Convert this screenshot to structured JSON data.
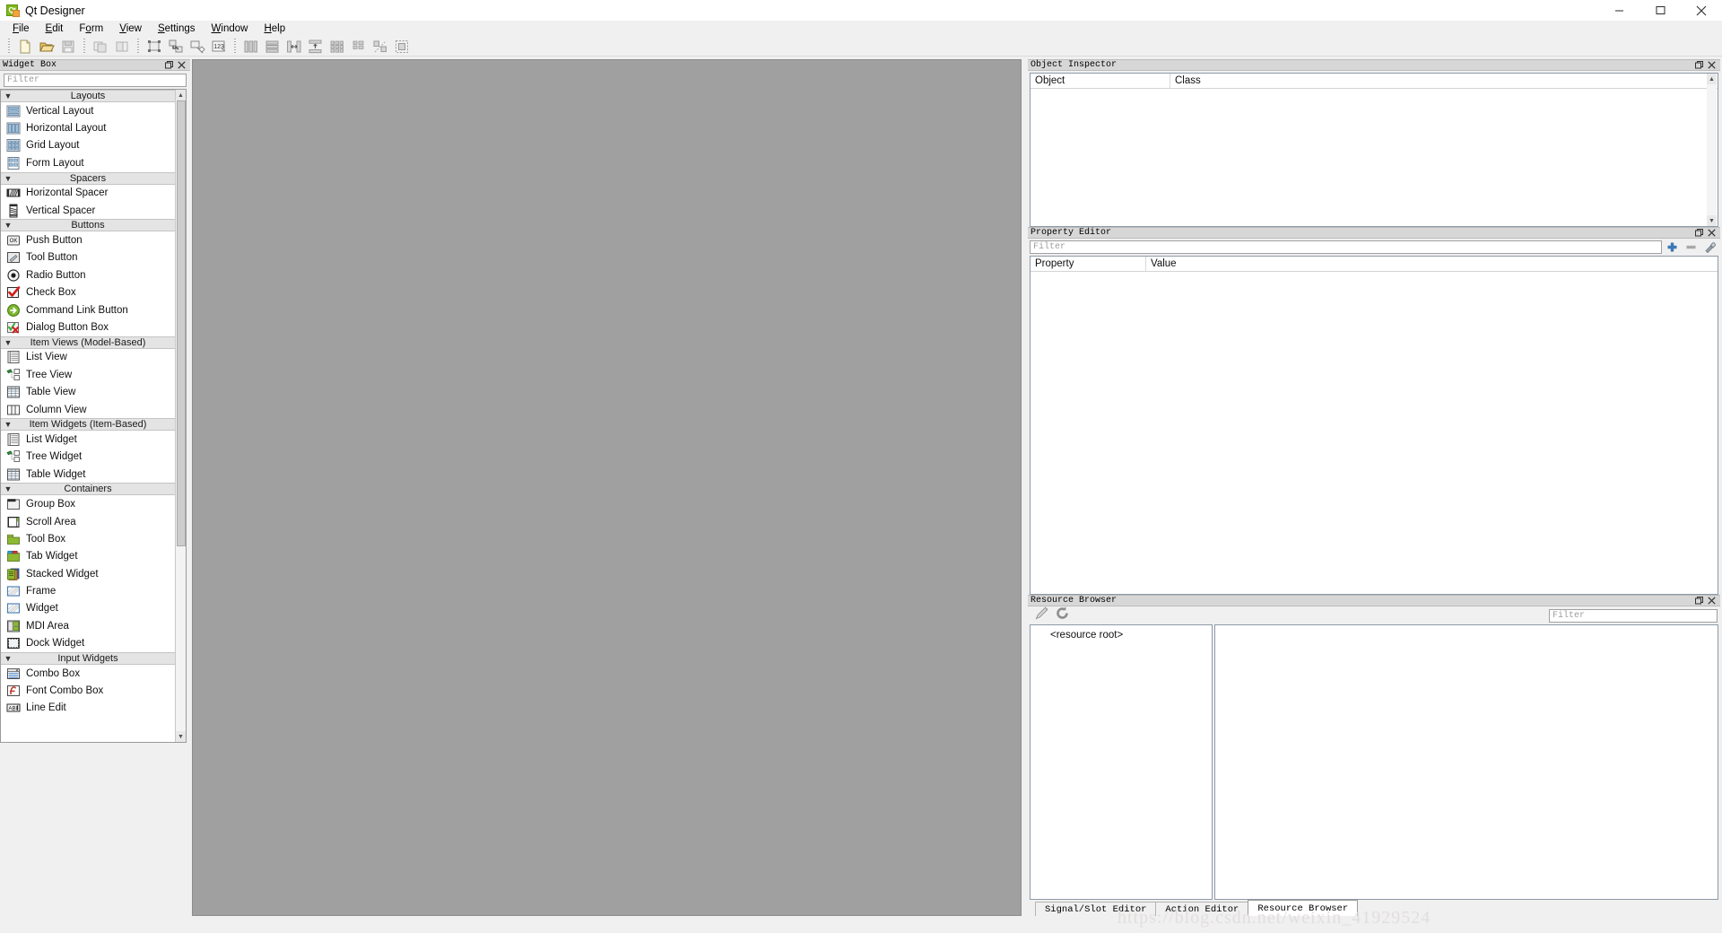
{
  "window": {
    "title": "Qt Designer",
    "logo_text": "Qt",
    "controls": {
      "minimize": "minimize-icon",
      "maximize": "maximize-icon",
      "close": "close-icon"
    }
  },
  "menubar": {
    "items": [
      {
        "label": "File",
        "mnemonic": "F"
      },
      {
        "label": "Edit",
        "mnemonic": "E"
      },
      {
        "label": "Form",
        "mnemonic": "o"
      },
      {
        "label": "View",
        "mnemonic": "V"
      },
      {
        "label": "Settings",
        "mnemonic": "S"
      },
      {
        "label": "Window",
        "mnemonic": "W"
      },
      {
        "label": "Help",
        "mnemonic": "H"
      }
    ]
  },
  "toolbar": {
    "groups": [
      {
        "buttons": [
          {
            "name": "new-form-icon",
            "enabled": true
          },
          {
            "name": "open-form-icon",
            "enabled": true
          },
          {
            "name": "save-form-icon",
            "enabled": false
          }
        ]
      },
      {
        "buttons": [
          {
            "name": "undo-icon",
            "enabled": false
          },
          {
            "name": "redo-icon",
            "enabled": false
          }
        ]
      },
      {
        "buttons": [
          {
            "name": "edit-widgets-icon",
            "enabled": true
          },
          {
            "name": "edit-signals-slots-icon",
            "enabled": true
          },
          {
            "name": "edit-buddies-icon",
            "enabled": true
          },
          {
            "name": "edit-tab-order-icon",
            "enabled": true
          }
        ]
      },
      {
        "buttons": [
          {
            "name": "layout-horizontally-icon",
            "enabled": false
          },
          {
            "name": "layout-vertically-icon",
            "enabled": false
          },
          {
            "name": "layout-splitter-horizontal-icon",
            "enabled": false
          },
          {
            "name": "layout-splitter-vertical-icon",
            "enabled": false
          },
          {
            "name": "layout-grid-icon",
            "enabled": false
          },
          {
            "name": "layout-form-icon",
            "enabled": false
          },
          {
            "name": "break-layout-icon",
            "enabled": false
          },
          {
            "name": "adjust-size-icon",
            "enabled": false
          }
        ]
      }
    ]
  },
  "widget_box": {
    "title": "Widget Box",
    "filter_placeholder": "Filter",
    "categories": [
      {
        "label": "Layouts",
        "expanded": true,
        "items": [
          {
            "label": "Vertical Layout",
            "icon": "vertical-layout-icon"
          },
          {
            "label": "Horizontal Layout",
            "icon": "horizontal-layout-icon"
          },
          {
            "label": "Grid Layout",
            "icon": "grid-layout-icon"
          },
          {
            "label": "Form Layout",
            "icon": "form-layout-icon"
          }
        ]
      },
      {
        "label": "Spacers",
        "expanded": true,
        "items": [
          {
            "label": "Horizontal Spacer",
            "icon": "horizontal-spacer-icon"
          },
          {
            "label": "Vertical Spacer",
            "icon": "vertical-spacer-icon"
          }
        ]
      },
      {
        "label": "Buttons",
        "expanded": true,
        "items": [
          {
            "label": "Push Button",
            "icon": "push-button-icon"
          },
          {
            "label": "Tool Button",
            "icon": "tool-button-icon"
          },
          {
            "label": "Radio Button",
            "icon": "radio-button-icon"
          },
          {
            "label": "Check Box",
            "icon": "check-box-icon"
          },
          {
            "label": "Command Link Button",
            "icon": "command-link-button-icon"
          },
          {
            "label": "Dialog Button Box",
            "icon": "dialog-button-box-icon"
          }
        ]
      },
      {
        "label": "Item Views (Model-Based)",
        "expanded": true,
        "items": [
          {
            "label": "List View",
            "icon": "list-view-icon"
          },
          {
            "label": "Tree View",
            "icon": "tree-view-icon"
          },
          {
            "label": "Table View",
            "icon": "table-view-icon"
          },
          {
            "label": "Column View",
            "icon": "column-view-icon"
          }
        ]
      },
      {
        "label": "Item Widgets (Item-Based)",
        "expanded": true,
        "items": [
          {
            "label": "List Widget",
            "icon": "list-widget-icon"
          },
          {
            "label": "Tree Widget",
            "icon": "tree-widget-icon"
          },
          {
            "label": "Table Widget",
            "icon": "table-widget-icon"
          }
        ]
      },
      {
        "label": "Containers",
        "expanded": true,
        "items": [
          {
            "label": "Group Box",
            "icon": "group-box-icon"
          },
          {
            "label": "Scroll Area",
            "icon": "scroll-area-icon"
          },
          {
            "label": "Tool Box",
            "icon": "tool-box-icon"
          },
          {
            "label": "Tab Widget",
            "icon": "tab-widget-icon"
          },
          {
            "label": "Stacked Widget",
            "icon": "stacked-widget-icon"
          },
          {
            "label": "Frame",
            "icon": "frame-icon"
          },
          {
            "label": "Widget",
            "icon": "widget-icon"
          },
          {
            "label": "MDI Area",
            "icon": "mdi-area-icon"
          },
          {
            "label": "Dock Widget",
            "icon": "dock-widget-icon"
          }
        ]
      },
      {
        "label": "Input Widgets",
        "expanded": true,
        "items": [
          {
            "label": "Combo Box",
            "icon": "combo-box-icon"
          },
          {
            "label": "Font Combo Box",
            "icon": "font-combo-box-icon"
          },
          {
            "label": "Line Edit",
            "icon": "line-edit-icon"
          }
        ]
      }
    ]
  },
  "object_inspector": {
    "title": "Object Inspector",
    "columns": [
      "Object",
      "Class"
    ],
    "rows": []
  },
  "property_editor": {
    "title": "Property Editor",
    "filter_placeholder": "Filter",
    "buttons": [
      {
        "name": "add-dynamic-property-icon"
      },
      {
        "name": "remove-dynamic-property-icon"
      },
      {
        "name": "configure-property-editor-icon"
      }
    ],
    "columns": [
      "Property",
      "Value"
    ],
    "rows": []
  },
  "resource_browser": {
    "title": "Resource Browser",
    "buttons": [
      {
        "name": "edit-resources-icon"
      },
      {
        "name": "reload-icon"
      }
    ],
    "filter_placeholder": "Filter",
    "root_label": "<resource root>",
    "files": []
  },
  "bottom_tabs": {
    "tabs": [
      {
        "label": "Signal/Slot Editor",
        "active": false
      },
      {
        "label": "Action Editor",
        "active": false
      },
      {
        "label": "Resource Browser",
        "active": true
      }
    ]
  },
  "watermark": {
    "text": "https://blog.csdn.net/weixin_41929524"
  },
  "colors": {
    "canvas": "#a0a0a0",
    "chrome": "#f0f0f0",
    "dock_title": "#d7d7d7",
    "category": "#e4e4e4",
    "panel_border": "#8d9aa8",
    "accent_green": "#80b918",
    "accent_orange": "#f2a33c"
  }
}
